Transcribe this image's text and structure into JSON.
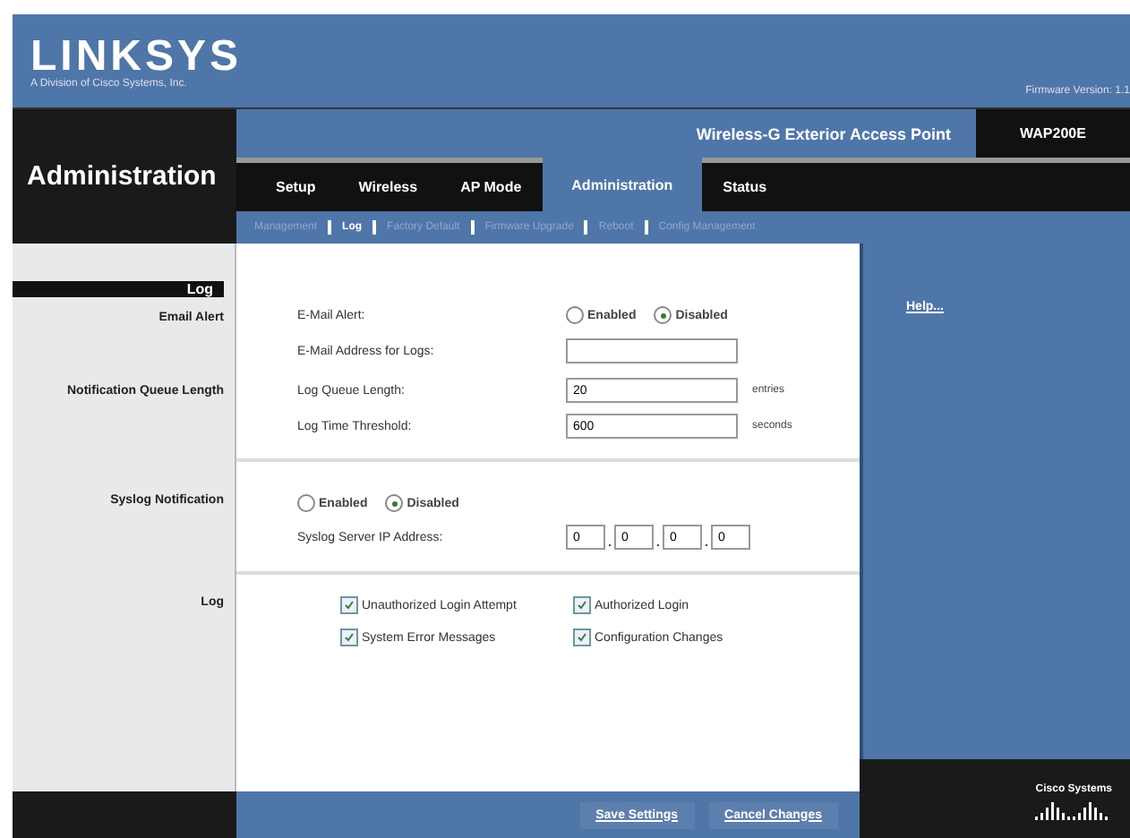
{
  "header": {
    "logo": "LINKSYS",
    "tagline": "A Division of Cisco Systems, Inc.",
    "firmware": "Firmware Version: 1.1"
  },
  "product": {
    "name": "Wireless-G Exterior Access Point",
    "model": "WAP200E"
  },
  "page_title": "Administration",
  "tabs": [
    {
      "label": "Setup",
      "selected": false
    },
    {
      "label": "Wireless",
      "selected": false
    },
    {
      "label": "AP Mode",
      "selected": false
    },
    {
      "label": "Administration",
      "selected": true
    },
    {
      "label": "Status",
      "selected": false
    }
  ],
  "subtabs": [
    {
      "label": "Management",
      "selected": false
    },
    {
      "label": "Log",
      "selected": true
    },
    {
      "label": "Factory Default",
      "selected": false
    },
    {
      "label": "Firmware Upgrade",
      "selected": false
    },
    {
      "label": "Reboot",
      "selected": false
    },
    {
      "label": "Config Management",
      "selected": false
    }
  ],
  "section_title": "Log",
  "sections": [
    {
      "label": "Email Alert"
    },
    {
      "label": "Notification Queue Length"
    },
    {
      "label": "Syslog Notification"
    },
    {
      "label": "Log"
    }
  ],
  "email_alert": {
    "label": "E-Mail Alert:",
    "options": [
      {
        "label": "Enabled",
        "selected": false
      },
      {
        "label": "Disabled",
        "selected": true
      }
    ]
  },
  "email_address": {
    "label": "E-Mail Address for Logs:"
  },
  "queue_length": {
    "label": "Log Queue Length:",
    "value": "20",
    "unit": "entries"
  },
  "time_threshold": {
    "label": "Log Time Threshold:",
    "value": "600",
    "unit": "seconds"
  },
  "syslog": {
    "options": [
      {
        "label": "Enabled",
        "selected": false
      },
      {
        "label": "Disabled",
        "selected": true
      }
    ],
    "ip_label": "Syslog Server IP Address:",
    "octets": [
      "0",
      "0",
      "0",
      "0"
    ]
  },
  "log_options": [
    {
      "label": "Unauthorized Login Attempt",
      "checked": true
    },
    {
      "label": "Authorized Login",
      "checked": true
    },
    {
      "label": "System Error Messages",
      "checked": true
    },
    {
      "label": "Configuration Changes",
      "checked": true
    }
  ],
  "help": "Help...",
  "buttons": [
    "Save Settings",
    "Cancel Changes"
  ],
  "cisco": "Cisco Systems"
}
